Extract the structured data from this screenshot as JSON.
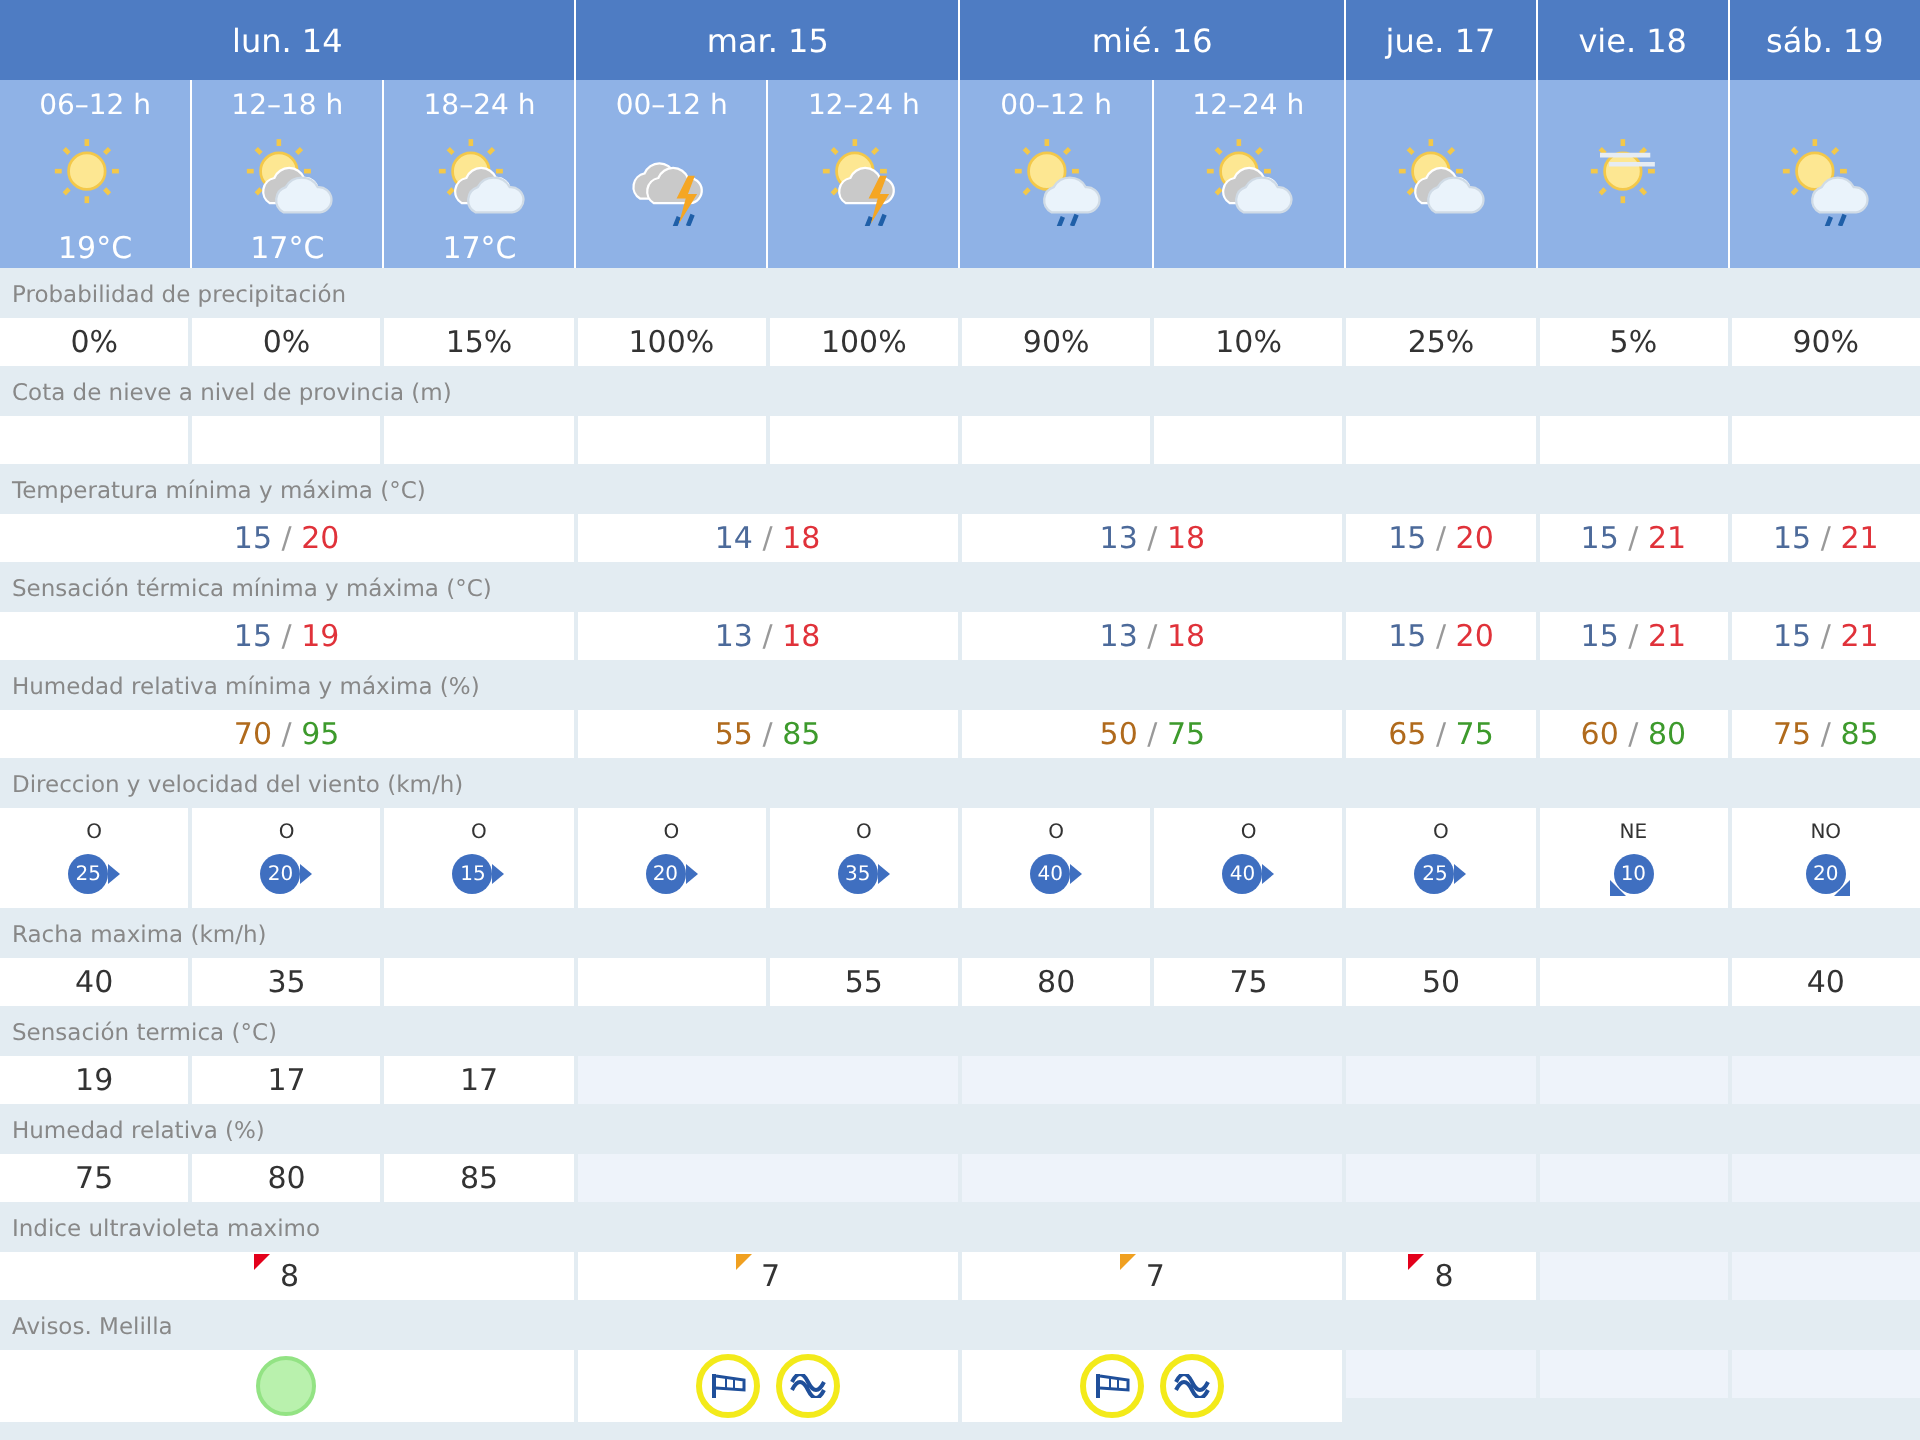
{
  "days": [
    {
      "label": "lun. 14",
      "periods": [
        {
          "label": "06–12 h",
          "kind": "sun",
          "temp": "19°C"
        },
        {
          "label": "12–18 h",
          "kind": "sun-cloud",
          "temp": "17°C"
        },
        {
          "label": "18–24 h",
          "kind": "sun-cloud",
          "temp": "17°C"
        }
      ]
    },
    {
      "label": "mar. 15",
      "periods": [
        {
          "label": "00–12 h",
          "kind": "storm-rain"
        },
        {
          "label": "12–24 h",
          "kind": "sun-storm-rain"
        }
      ]
    },
    {
      "label": "mié. 16",
      "periods": [
        {
          "label": "00–12 h",
          "kind": "sun-rain"
        },
        {
          "label": "12–24 h",
          "kind": "sun-cloud"
        }
      ]
    },
    {
      "label": "jue. 17",
      "periods": [
        {
          "kind": "sun-cloud"
        }
      ]
    },
    {
      "label": "vie. 18",
      "periods": [
        {
          "kind": "haze-sun"
        }
      ]
    },
    {
      "label": "sáb. 19",
      "periods": [
        {
          "kind": "sun-cloud-rain"
        }
      ]
    }
  ],
  "rows": [
    {
      "label": "Probabilidad de precipitación",
      "kind": "text",
      "days": [
        {
          "periods": [
            {
              "available": true,
              "value": "0%"
            },
            {
              "available": true,
              "value": "0%"
            },
            {
              "available": true,
              "value": "15%"
            }
          ]
        },
        {
          "periods": [
            {
              "available": true,
              "value": "100%"
            },
            {
              "available": true,
              "value": "100%"
            }
          ]
        },
        {
          "periods": [
            {
              "available": true,
              "value": "90%"
            },
            {
              "available": true,
              "value": "10%"
            }
          ]
        },
        {
          "available": true,
          "value": "25%"
        },
        {
          "available": true,
          "value": "5%"
        },
        {
          "available": true,
          "value": "90%"
        }
      ]
    },
    {
      "label": "Cota de nieve a nivel de provincia (m)",
      "kind": "text",
      "days": [
        {
          "periods": [
            {
              "available": true
            },
            {
              "available": true
            },
            {
              "available": true
            }
          ]
        },
        {
          "periods": [
            {
              "available": true
            },
            {
              "available": true
            }
          ]
        },
        {
          "periods": [
            {
              "available": true
            },
            {
              "available": true
            }
          ]
        },
        {
          "available": true
        },
        {
          "available": true
        },
        {
          "available": true
        }
      ]
    },
    {
      "label": "Temperatura mínima y máxima (°C)",
      "kind": "temperature",
      "separator": "/",
      "days": [
        {
          "available": true,
          "min": "15",
          "max": "20"
        },
        {
          "available": true,
          "min": "14",
          "max": "18"
        },
        {
          "available": true,
          "min": "13",
          "max": "18"
        },
        {
          "available": true,
          "min": "15",
          "max": "20"
        },
        {
          "available": true,
          "min": "15",
          "max": "21"
        },
        {
          "available": true,
          "min": "15",
          "max": "21"
        }
      ]
    },
    {
      "label": "Sensación térmica mínima y máxima (°C)",
      "kind": "temperature",
      "separator": "/",
      "days": [
        {
          "available": true,
          "min": "15",
          "max": "19"
        },
        {
          "available": true,
          "min": "13",
          "max": "18"
        },
        {
          "available": true,
          "min": "13",
          "max": "18"
        },
        {
          "available": true,
          "min": "15",
          "max": "20"
        },
        {
          "available": true,
          "min": "15",
          "max": "21"
        },
        {
          "available": true,
          "min": "15",
          "max": "21"
        }
      ]
    },
    {
      "label": "Humedad relativa mínima y máxima (%)",
      "kind": "humidity",
      "separator": "/",
      "days": [
        {
          "available": true,
          "min": "70",
          "max": "95"
        },
        {
          "available": true,
          "min": "55",
          "max": "85"
        },
        {
          "available": true,
          "min": "50",
          "max": "75"
        },
        {
          "available": true,
          "min": "65",
          "max": "75"
        },
        {
          "available": true,
          "min": "60",
          "max": "80"
        },
        {
          "available": true,
          "min": "75",
          "max": "85"
        }
      ]
    },
    {
      "label": "Direccion y velocidad del viento (km/h)",
      "kind": "wind",
      "days": [
        {
          "periods": [
            {
              "available": true,
              "dir": "O",
              "speed": "25",
              "kind": "east"
            },
            {
              "available": true,
              "dir": "O",
              "speed": "20",
              "kind": "east"
            },
            {
              "available": true,
              "dir": "O",
              "speed": "15",
              "kind": "east"
            }
          ]
        },
        {
          "periods": [
            {
              "available": true,
              "dir": "O",
              "speed": "20",
              "kind": "east"
            },
            {
              "available": true,
              "dir": "O",
              "speed": "35",
              "kind": "east"
            }
          ]
        },
        {
          "periods": [
            {
              "available": true,
              "dir": "O",
              "speed": "40",
              "kind": "east"
            },
            {
              "available": true,
              "dir": "O",
              "speed": "40",
              "kind": "east"
            }
          ]
        },
        {
          "available": true,
          "dir": "O",
          "speed": "25",
          "kind": "east"
        },
        {
          "available": true,
          "dir": "NE",
          "speed": "10",
          "kind": "southwest"
        },
        {
          "available": true,
          "dir": "NO",
          "speed": "20",
          "kind": "southeast"
        }
      ]
    },
    {
      "label": "Racha maxima (km/h)",
      "kind": "text",
      "days": [
        {
          "periods": [
            {
              "available": true,
              "value": "40"
            },
            {
              "available": true,
              "value": "35"
            },
            {
              "available": true
            }
          ]
        },
        {
          "periods": [
            {
              "available": true
            },
            {
              "available": true,
              "value": "55"
            }
          ]
        },
        {
          "periods": [
            {
              "available": true,
              "value": "80"
            },
            {
              "available": true,
              "value": "75"
            }
          ]
        },
        {
          "available": true,
          "value": "50"
        },
        {
          "available": true
        },
        {
          "available": true,
          "value": "40"
        }
      ]
    },
    {
      "label": "Sensación termica (°C)",
      "kind": "text",
      "days": [
        {
          "periods": [
            {
              "available": true,
              "value": "19"
            },
            {
              "available": true,
              "value": "17"
            },
            {
              "available": true,
              "value": "17"
            }
          ]
        },
        {
          "available": false
        },
        {
          "available": false
        },
        {
          "available": false
        },
        {
          "available": false
        },
        {
          "available": false
        }
      ]
    },
    {
      "label": "Humedad relativa (%)",
      "kind": "text",
      "days": [
        {
          "periods": [
            {
              "available": true,
              "value": "75"
            },
            {
              "available": true,
              "value": "80"
            },
            {
              "available": true,
              "value": "85"
            }
          ]
        },
        {
          "available": false
        },
        {
          "available": false
        },
        {
          "available": false
        },
        {
          "available": false
        },
        {
          "available": false
        }
      ]
    },
    {
      "label": "Indice ultravioleta maximo",
      "kind": "uv",
      "days": [
        {
          "available": true,
          "value": "8",
          "color": "#e3001b"
        },
        {
          "available": true,
          "value": "7",
          "color": "#f0a020"
        },
        {
          "available": true,
          "value": "7",
          "color": "#f0a020"
        },
        {
          "available": true,
          "value": "8",
          "color": "#e3001b"
        },
        {
          "available": false
        },
        {
          "available": false
        }
      ]
    },
    {
      "label": "Avisos. Melilla",
      "kind": "warnings",
      "days": [
        {
          "available": true,
          "warnings": [
            {
              "kind": "none"
            }
          ]
        },
        {
          "available": true,
          "warnings": [
            {
              "kind": "wind"
            },
            {
              "kind": "coast"
            }
          ]
        },
        {
          "available": true,
          "warnings": [
            {
              "kind": "wind"
            },
            {
              "kind": "coast"
            }
          ]
        },
        {
          "available": false
        },
        {
          "available": false
        },
        {
          "available": false
        }
      ]
    }
  ]
}
